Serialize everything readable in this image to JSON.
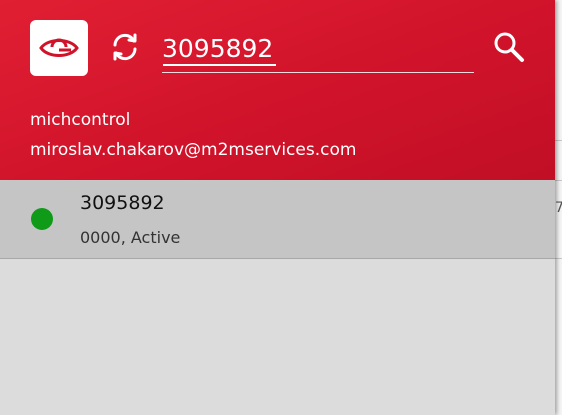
{
  "search": {
    "value": "3095892"
  },
  "user": {
    "name": "michcontrol",
    "email": "miroslav.chakarov@m2mservices.com"
  },
  "results": [
    {
      "title": "3095892",
      "subtitle": "0000, Active",
      "status_color": "#0f9a18"
    }
  ],
  "background_peek": {
    "glyph": "7"
  },
  "icons": {
    "logo": "eye-icon",
    "refresh": "refresh-icon",
    "search": "search-icon"
  },
  "colors": {
    "header": "#d0132a",
    "row_selected": "#c5c5c5",
    "drawer_bg": "#dcdcdc",
    "status_active": "#0f9a18"
  }
}
